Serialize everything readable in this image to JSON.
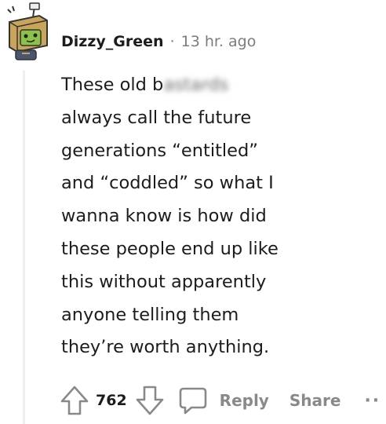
{
  "comment": {
    "username": "Dizzy_Green",
    "separator": "·",
    "timestamp": "13 hr. ago",
    "body_lines": [
      {
        "pre": "These old b",
        "blurred": "astards"
      },
      {
        "text": "always call the future"
      },
      {
        "text": "generations “entitled”"
      },
      {
        "text": "and “coddled” so what I"
      },
      {
        "text": "wanna know is how did"
      },
      {
        "text": "these people end up like"
      },
      {
        "text": "this without apparently"
      },
      {
        "text": "anyone telling them"
      },
      {
        "text": "they’re worth anything."
      }
    ]
  },
  "actions": {
    "vote_count": "762",
    "reply_label": "Reply",
    "share_label": "Share",
    "more_label": "··"
  },
  "colors": {
    "text": "#1c1c1c",
    "muted": "#7c7c7c",
    "action_gray": "#878a8c",
    "thread_line": "#edeff1",
    "avatar_box": "#c9a55c",
    "avatar_face": "#8bc34a"
  },
  "icons": [
    "avatar-image",
    "upvote-icon",
    "downvote-icon",
    "comment-icon",
    "more-icon"
  ]
}
